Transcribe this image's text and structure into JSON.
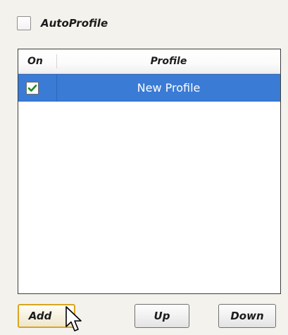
{
  "auto_profile": {
    "label": "AutoProfile",
    "checked": false
  },
  "table": {
    "columns": [
      "On",
      "Profile"
    ],
    "rows": [
      {
        "on": true,
        "name": "New Profile",
        "selected": true
      }
    ],
    "selection_color": "#3a7bd5"
  },
  "buttons": {
    "add": "Add",
    "up": "Up",
    "down": "Down"
  },
  "icons": {
    "row_check": "checkmark-icon",
    "cursor": "mouse-pointer-icon"
  }
}
